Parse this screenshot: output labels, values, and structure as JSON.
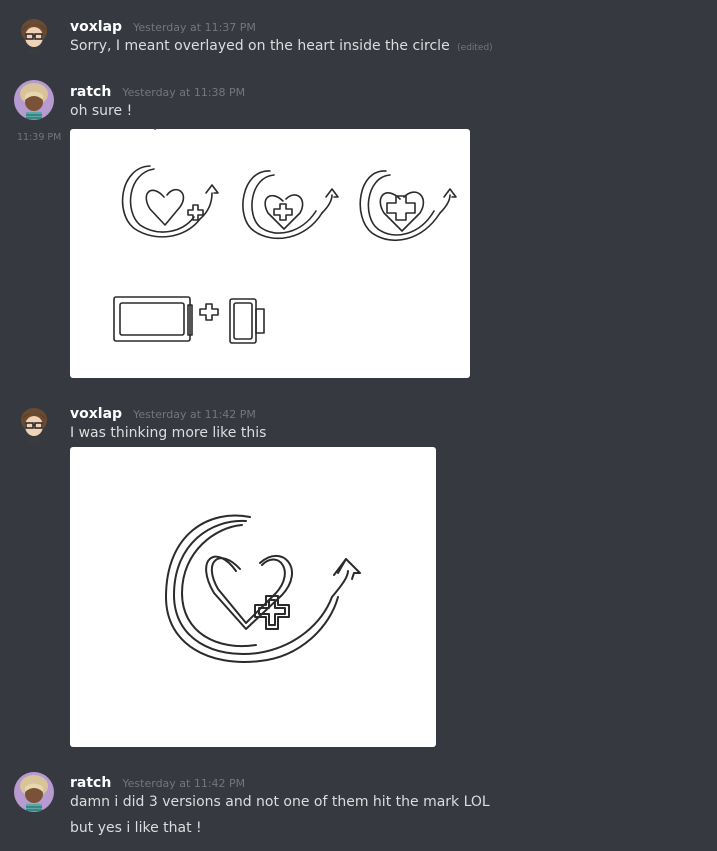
{
  "messages": [
    {
      "username": "voxlap",
      "timestamp": "Yesterday at 11:37 PM",
      "text": "Sorry, I meant overlayed on the heart inside the circle",
      "edited": "(edited)"
    },
    {
      "username": "ratch",
      "timestamp": "Yesterday at 11:38 PM",
      "text": "oh sure !",
      "followup_time": "11:39 PM"
    },
    {
      "username": "voxlap",
      "timestamp": "Yesterday at 11:42 PM",
      "text": "I was thinking more like this"
    },
    {
      "username": "ratch",
      "timestamp": "Yesterday at 11:42 PM",
      "text": "damn i did 3 versions and not one of them hit the mark LOL",
      "text2": "but yes i like that !"
    }
  ],
  "colors": {
    "background": "#36393f",
    "highlight": "#32353b",
    "username": "#ffffff",
    "text": "#dcddde",
    "muted": "#72767d"
  }
}
